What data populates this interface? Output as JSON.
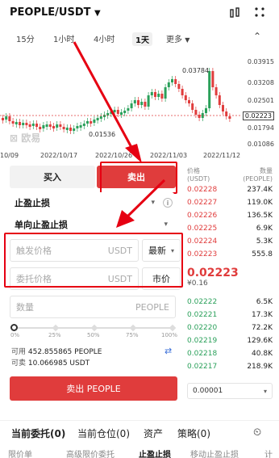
{
  "header": {
    "pair": "PEOPLE/USDT"
  },
  "timeframes": {
    "t1": "15分",
    "t2": "1小时",
    "t3": "4小时",
    "t4": "1天",
    "more": "更多"
  },
  "chart": {
    "y_ticks": [
      "0.03915",
      "0.03208",
      "0.02501",
      "0.01794",
      "0.01086"
    ],
    "current_price_tag": "0.02223",
    "x_ticks": [
      "10/09",
      "2022/10/17",
      "2022/10/26",
      "2022/11/03",
      "2022/11/12"
    ],
    "high_label": "0.03784",
    "low_label": "0.01536",
    "watermark": "欧易"
  },
  "trade": {
    "buy_tab": "买入",
    "sell_tab": "卖出",
    "order_type": "止盈止损",
    "sub_type": "单向止盈止损",
    "trigger_placeholder": "触发价格",
    "trigger_unit": "USDT",
    "trigger_mode": "最新",
    "order_price_placeholder": "委托价格",
    "order_price_unit": "USDT",
    "market_btn": "市价",
    "amount_placeholder": "数量",
    "amount_unit": "PEOPLE",
    "slider_marks": [
      "0%",
      "25%",
      "50%",
      "75%",
      "100%"
    ],
    "available_label": "可用",
    "available_value": "452.855865 PEOPLE",
    "sellable_label": "可卖",
    "sellable_value": "10.066985 USDT",
    "submit": "卖出 PEOPLE"
  },
  "orderbook": {
    "price_header": "价格\n(USDT)",
    "qty_header": "数量\n(PEOPLE)",
    "asks": [
      {
        "price": "0.02228",
        "qty": "237.4K"
      },
      {
        "price": "0.02227",
        "qty": "119.0K"
      },
      {
        "price": "0.02226",
        "qty": "136.5K"
      },
      {
        "price": "0.02225",
        "qty": "6.9K"
      },
      {
        "price": "0.02224",
        "qty": "5.3K"
      },
      {
        "price": "0.02223",
        "qty": "555.8"
      }
    ],
    "last_price": "0.02223",
    "last_price_fiat": "¥0.16",
    "bids": [
      {
        "price": "0.02222",
        "qty": "6.5K"
      },
      {
        "price": "0.02221",
        "qty": "17.3K"
      },
      {
        "price": "0.02220",
        "qty": "72.2K"
      },
      {
        "price": "0.02219",
        "qty": "129.6K"
      },
      {
        "price": "0.02218",
        "qty": "40.8K"
      },
      {
        "price": "0.02217",
        "qty": "218.9K"
      }
    ],
    "precision": "0.00001"
  },
  "bottom": {
    "tabs": [
      "当前委托(0)",
      "当前仓位(0)",
      "资产",
      "策略(0)"
    ],
    "subtabs": [
      "限价单",
      "高级限价委托",
      "止盈止损",
      "移动止盈止损",
      "计"
    ]
  },
  "colors": {
    "red": "#e03c3c",
    "green": "#2aa05a",
    "annotation": "#e60012"
  }
}
